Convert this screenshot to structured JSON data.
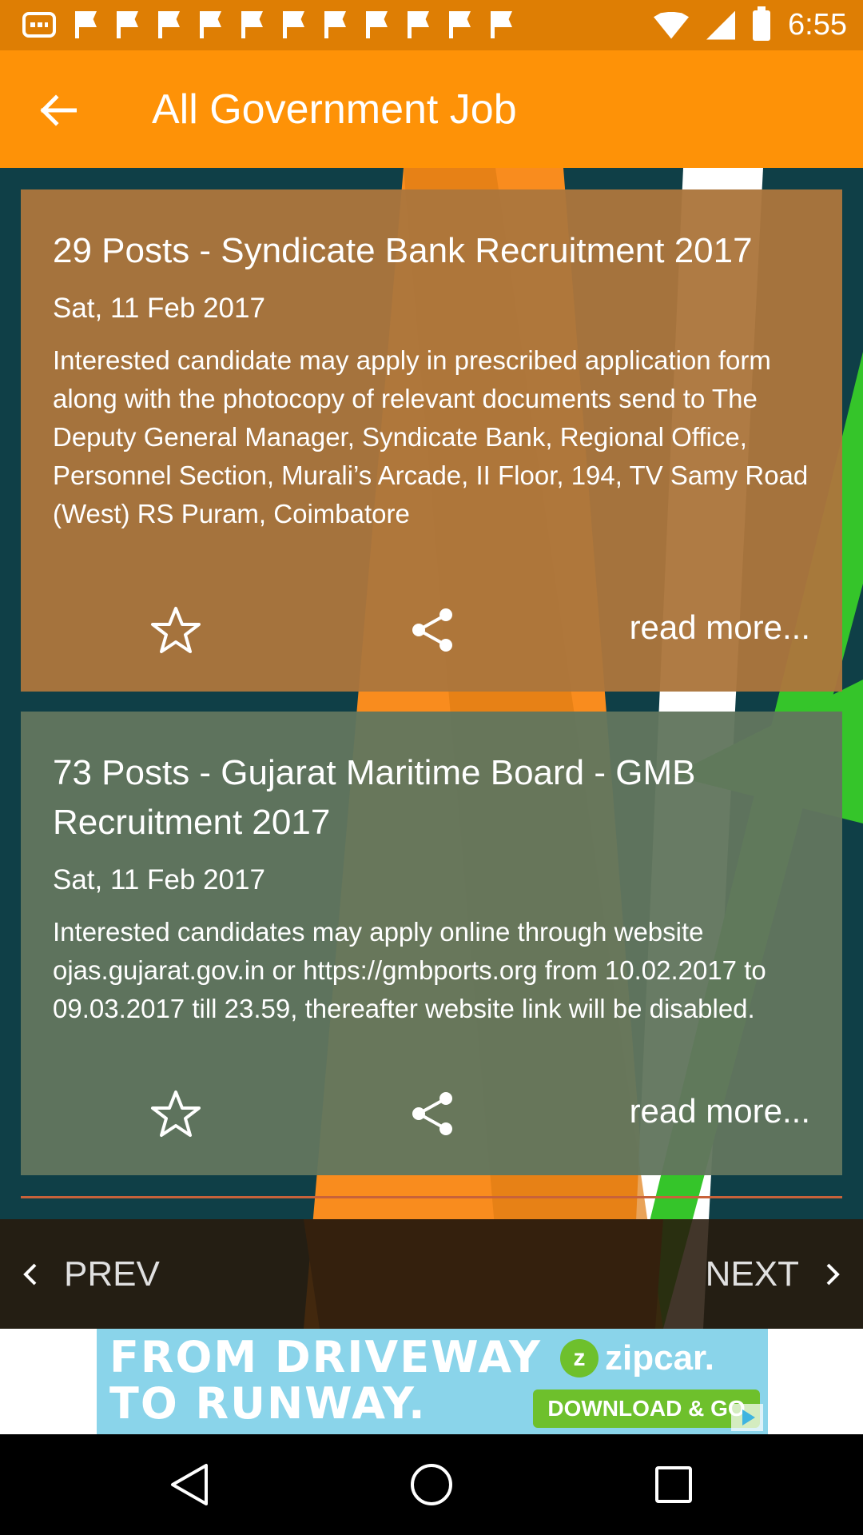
{
  "status_bar": {
    "time": "6:55",
    "left_icons": [
      "chat-icon",
      "flag-icon",
      "flag-icon",
      "flag-icon",
      "flag-icon",
      "flag-icon",
      "flag-icon",
      "flag-icon",
      "flag-icon",
      "flag-icon",
      "flag-icon",
      "flag-icon"
    ],
    "right_icons": [
      "wifi-icon",
      "signal-icon",
      "battery-icon"
    ]
  },
  "app_bar": {
    "title": "All Government Job",
    "back_icon": "arrow-back-icon"
  },
  "jobs": [
    {
      "title": "29 Posts - Syndicate Bank Recruitment 2017",
      "date": "Sat, 11 Feb 2017",
      "description": "Interested candidate may apply in prescribed application form along with the photocopy of relevant documents send to The Deputy General Manager, Syndicate Bank, Regional Office, Personnel Section, Murali’s Arcade, II Floor, 194, TV Samy Road (West) RS Puram, Coimbatore",
      "read_more": "read more..."
    },
    {
      "title": "73 Posts - Gujarat Maritime Board - GMB Recruitment 2017",
      "date": "Sat, 11 Feb 2017",
      "description": "Interested candidates may apply online through website ojas.gujarat.gov.in or https://gmbports.org from 10.02.2017 to 09.03.2017 till 23.59, thereafter website link will be disabled.",
      "read_more": "read more..."
    }
  ],
  "pagination": {
    "prev_label": "PREV",
    "next_label": "NEXT"
  },
  "ad": {
    "headline_line1": "FROM DRIVEWAY",
    "headline_line2": "TO RUNWAY.",
    "brand": "zipcar.",
    "brand_mark": "z",
    "cta": "DOWNLOAD & GO"
  },
  "colors": {
    "status_bar": "#de7e04",
    "app_bar": "#fe9207",
    "card_1": "#ac763c",
    "card_2": "#62765e",
    "nav_bar": "#281a0c"
  }
}
